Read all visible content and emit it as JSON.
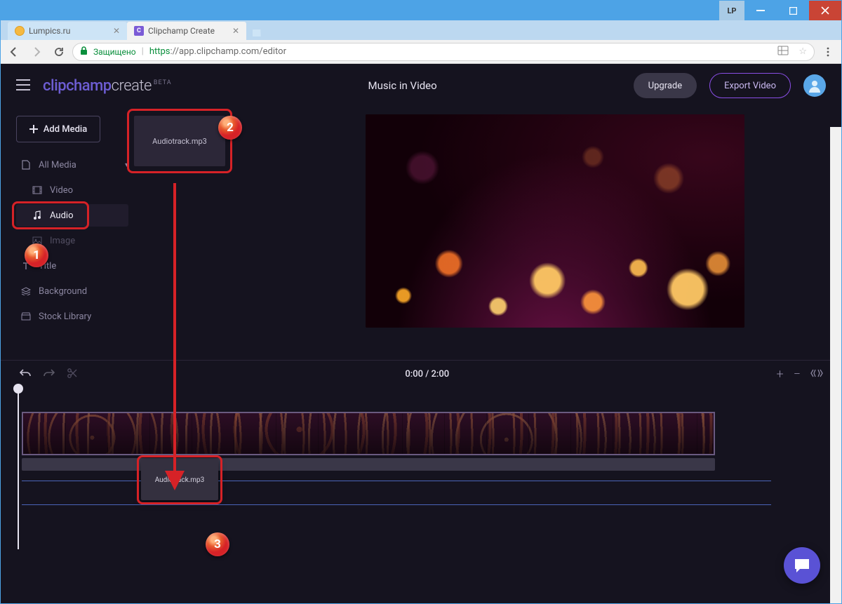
{
  "window": {
    "lp_label": "LP"
  },
  "browser": {
    "tabs": [
      {
        "title": "Lumpics.ru"
      },
      {
        "title": "Clipchamp Create"
      }
    ],
    "secure_label": "Защищено",
    "url_protocol": "https",
    "url_rest": "://app.clipchamp.com/editor"
  },
  "header": {
    "logo_brand": "clipchamp",
    "logo_sub": "create",
    "logo_beta": "BETA",
    "project_title": "Music in Video",
    "upgrade": "Upgrade",
    "export": "Export Video"
  },
  "sidebar": {
    "add_media": "Add Media",
    "items": [
      {
        "label": "All Media"
      },
      {
        "label": "Video"
      },
      {
        "label": "Audio"
      },
      {
        "label": "Image"
      },
      {
        "label": "Title"
      },
      {
        "label": "Background"
      },
      {
        "label": "Stock Library"
      }
    ]
  },
  "media": {
    "audio_thumb_label": "Audiotrack.mp3",
    "audio_drag_label": "Audiotrack.mp3"
  },
  "playback": {
    "time": "0:00 / 2:00"
  },
  "annotations": {
    "b1": "1",
    "b2": "2",
    "b3": "3"
  }
}
